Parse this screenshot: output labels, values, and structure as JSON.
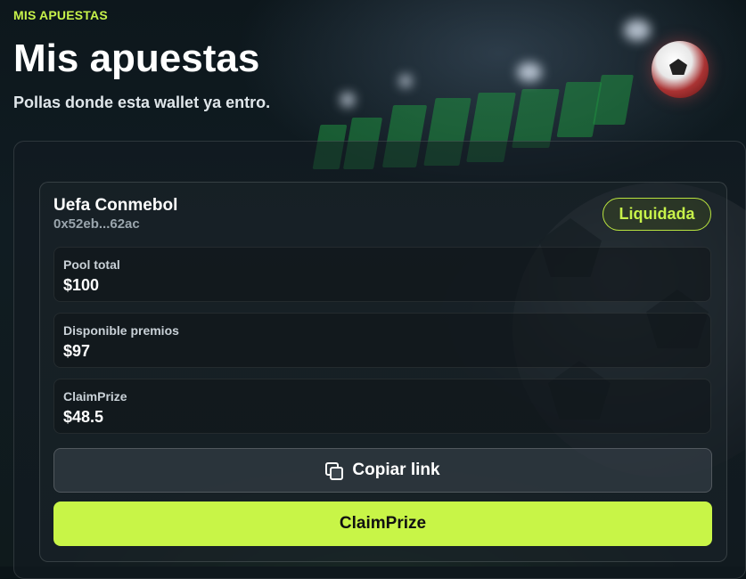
{
  "header": {
    "eyebrow": "MIS APUESTAS",
    "title": "Mis apuestas",
    "subtitle": "Pollas donde esta wallet ya entro."
  },
  "bet": {
    "name": "Uefa Conmebol",
    "address": "0x52eb...62ac",
    "status": "Liquidada",
    "stats": [
      {
        "label": "Pool total",
        "value": "$100"
      },
      {
        "label": "Disponible premios",
        "value": "$97"
      },
      {
        "label": "ClaimPrize",
        "value": "$48.5"
      }
    ],
    "copy_label": "Copiar link",
    "claim_label": "ClaimPrize"
  },
  "colors": {
    "accent": "#c8f547",
    "background": "#0b1418"
  },
  "icons": {
    "copy": "copy-icon"
  }
}
